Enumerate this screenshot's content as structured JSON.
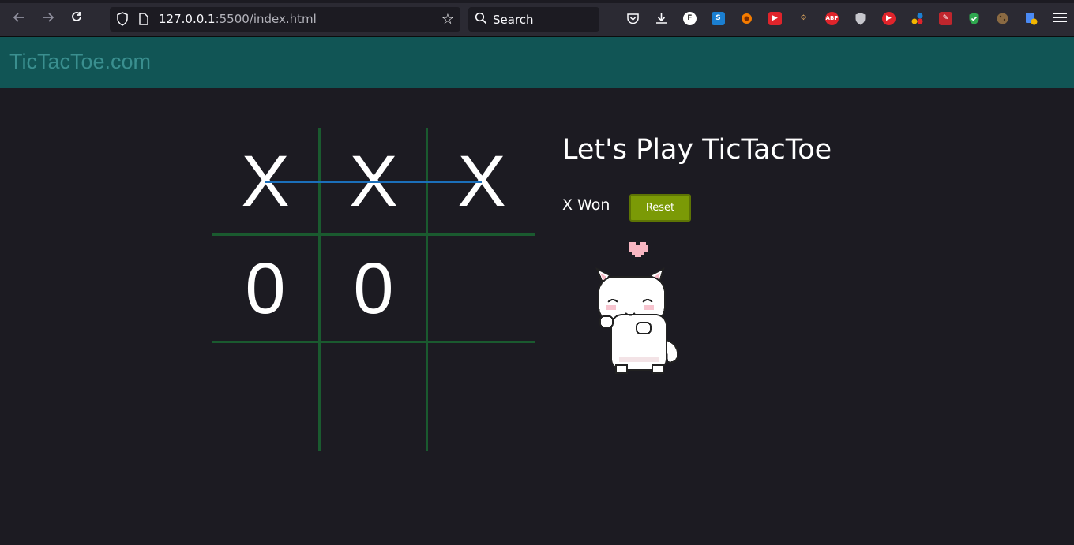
{
  "browser": {
    "url_host": "127.0.0.1",
    "url_path": ":5500/index.html",
    "search_placeholder": "Search"
  },
  "page": {
    "brand": "TicTacToe.com",
    "title": "Let's Play TicTacToe",
    "status": "X Won",
    "reset_label": "Reset"
  },
  "board": {
    "cells": [
      "X",
      "X",
      "X",
      "0",
      "0",
      "",
      "",
      "",
      ""
    ],
    "winning_row": 1
  },
  "colors": {
    "page_bg": "#1c1b22",
    "navbar_bg": "#115555",
    "brand_text": "#3a8f8f",
    "grid_line": "#1a5a2f",
    "win_line": "#1b6fba",
    "reset_bg": "#7b9a06"
  },
  "icons": [
    "back-arrow-icon",
    "forward-arrow-icon",
    "reload-icon",
    "shield-icon",
    "page-icon",
    "star-icon",
    "search-icon",
    "pocket-icon",
    "download-icon",
    "menu-icon",
    "heart-icon"
  ]
}
